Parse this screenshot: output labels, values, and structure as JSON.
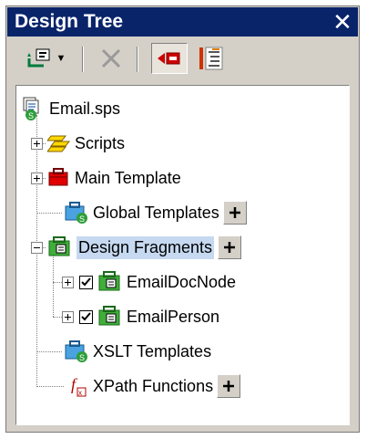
{
  "panel": {
    "title": "Design Tree",
    "close_icon": "close-icon"
  },
  "toolbar": {
    "items": [
      {
        "name": "add-component-icon",
        "has_dropdown": true
      },
      {
        "name": "delete-icon",
        "enabled": false
      },
      {
        "name": "sync-tree-icon",
        "pressed": true
      },
      {
        "name": "toggle-view-icon"
      }
    ]
  },
  "tree": {
    "root": {
      "label": "Email.sps",
      "icon": "sps-file-icon"
    },
    "items": [
      {
        "label": "Scripts",
        "icon": "scripts-icon",
        "expander": "plus"
      },
      {
        "label": "Main Template",
        "icon": "main-template-icon",
        "expander": "plus"
      },
      {
        "label": "Global Templates",
        "icon": "global-templates-icon",
        "add_button": true
      },
      {
        "label": "Design Fragments",
        "icon": "design-fragments-icon",
        "expander": "minus",
        "add_button": true,
        "selected": true,
        "children": [
          {
            "label": "EmailDocNode",
            "icon": "fragment-icon",
            "checked": true,
            "expander": "plus"
          },
          {
            "label": "EmailPerson",
            "icon": "fragment-icon",
            "checked": true,
            "expander": "plus"
          }
        ]
      },
      {
        "label": "XSLT Templates",
        "icon": "xslt-templates-icon"
      },
      {
        "label": "XPath Functions",
        "icon": "xpath-functions-icon",
        "add_button": true
      }
    ]
  },
  "colors": {
    "titlebar": "#0a246a",
    "selection": "#c6d9f1",
    "panel": "#d4d0c8"
  }
}
